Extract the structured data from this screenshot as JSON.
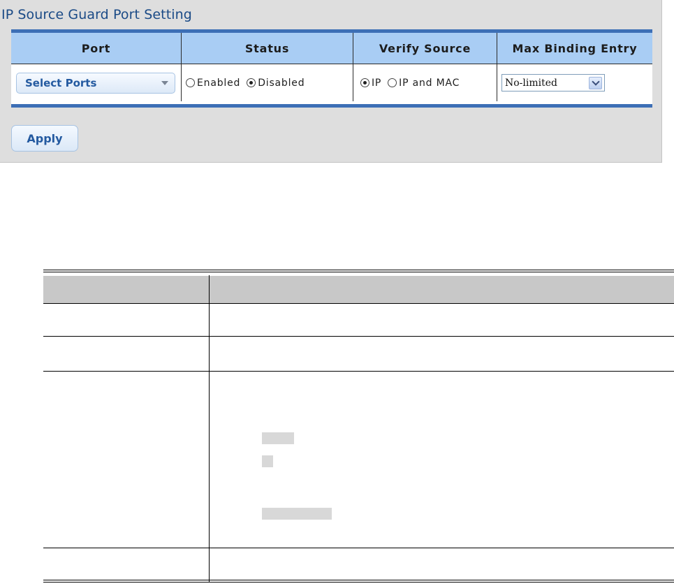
{
  "panel": {
    "title": "IP Source Guard Port Setting",
    "columns": [
      "Port",
      "Status",
      "Verify Source",
      "Max Binding Entry"
    ],
    "port_select": {
      "label": "Select Ports"
    },
    "status": {
      "options": [
        {
          "label": "Enabled",
          "checked": false
        },
        {
          "label": "Disabled",
          "checked": true
        }
      ]
    },
    "verify_source": {
      "options": [
        {
          "label": "IP",
          "checked": true
        },
        {
          "label": "IP and MAC",
          "checked": false
        }
      ]
    },
    "max_binding": {
      "value": "No-limited"
    },
    "apply_label": "Apply"
  },
  "colors": {
    "title": "#1a4a86",
    "header_bg": "#a9cdf4",
    "table_border": "#3d6fb6",
    "panel_bg": "#dedede",
    "button_text": "#245aa0"
  }
}
